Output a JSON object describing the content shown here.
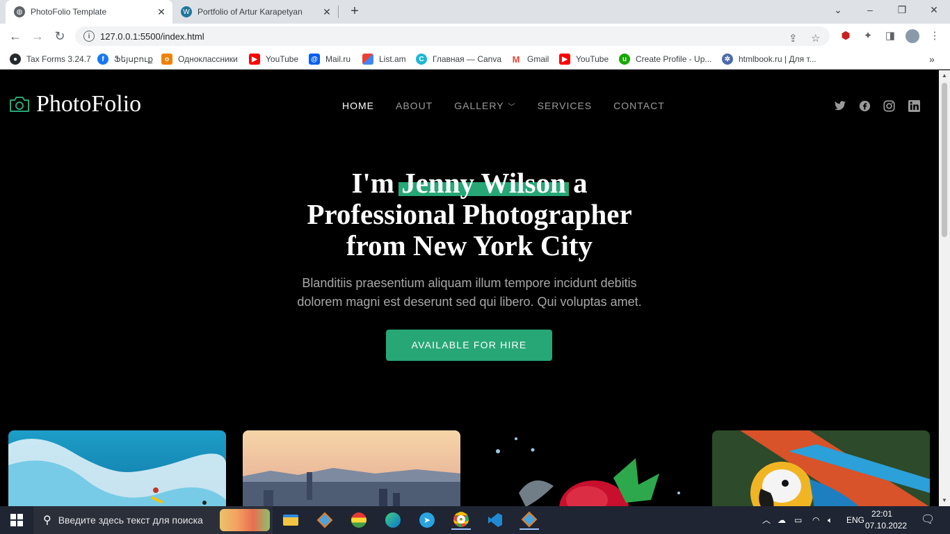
{
  "browser": {
    "tabs": [
      {
        "title": "PhotoFolio Template",
        "active": true
      },
      {
        "title": "Portfolio of Artur Karapetyan",
        "active": false
      }
    ],
    "url": "127.0.0.1:5500/index.html",
    "bookmarks": [
      {
        "label": "Tax Forms 3.24.7",
        "icon": "github-icon",
        "color": "#24292e"
      },
      {
        "label": "Ֆեյսբուք",
        "icon": "facebook-icon",
        "color": "#1877f2"
      },
      {
        "label": "Одноклассники",
        "icon": "odnoklassniki-icon",
        "color": "#ee8208"
      },
      {
        "label": "YouTube",
        "icon": "youtube-icon",
        "color": "#ff0000"
      },
      {
        "label": "Mail.ru",
        "icon": "mailru-icon",
        "color": "#005ff9"
      },
      {
        "label": "List.am",
        "icon": "listam-icon",
        "color": "#f4b400"
      },
      {
        "label": "Главная — Canva",
        "icon": "canva-icon",
        "color": "#1fb5d8"
      },
      {
        "label": "Gmail",
        "icon": "gmail-icon",
        "color": "#ea4335"
      },
      {
        "label": "YouTube",
        "icon": "youtube-icon",
        "color": "#ff0000"
      },
      {
        "label": "Create Profile - Up...",
        "icon": "upwork-icon",
        "color": "#14a800"
      },
      {
        "label": "htmlbook.ru | Для т...",
        "icon": "htmlbook-icon",
        "color": "#4b6aa8"
      }
    ]
  },
  "site": {
    "logo": "PhotoFolio",
    "nav": [
      "HOME",
      "ABOUT",
      "GALLERY",
      "SERVICES",
      "CONTACT"
    ],
    "hero": {
      "prefix": "I'm ",
      "name": "Jenny Wilson",
      "suffix": " a",
      "line2": "Professional Photographer",
      "line3": "from New York City",
      "para1": "Blanditiis praesentium aliquam illum tempore incidunt debitis",
      "para2": "dolorem magni est deserunt sed qui libero. Qui voluptas amet.",
      "cta": "AVAILABLE FOR HIRE"
    },
    "accent": "#27a776"
  },
  "taskbar": {
    "search_placeholder": "Введите здесь текст для поиска",
    "lang": "ENG",
    "time": "22:01",
    "date": "07.10.2022"
  }
}
